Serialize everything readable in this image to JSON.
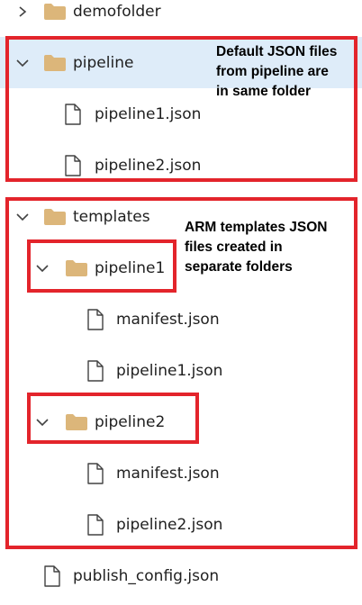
{
  "tree": {
    "rows": [
      {
        "label": "demofolder",
        "kind": "folder",
        "expanded": false,
        "selected": false
      },
      {
        "label": "pipeline",
        "kind": "folder",
        "expanded": true,
        "selected": true
      },
      {
        "label": "pipeline1.json",
        "kind": "file"
      },
      {
        "label": "pipeline2.json",
        "kind": "file"
      },
      {
        "label": "templates",
        "kind": "folder",
        "expanded": true,
        "selected": false
      },
      {
        "label": "pipeline1",
        "kind": "folder",
        "expanded": true,
        "selected": false
      },
      {
        "label": "manifest.json",
        "kind": "file"
      },
      {
        "label": "pipeline1.json",
        "kind": "file"
      },
      {
        "label": "pipeline2",
        "kind": "folder",
        "expanded": true,
        "selected": false
      },
      {
        "label": "manifest.json",
        "kind": "file"
      },
      {
        "label": "pipeline2.json",
        "kind": "file"
      },
      {
        "label": "publish_config.json",
        "kind": "file"
      }
    ]
  },
  "annotations": {
    "note1": "Default JSON files\nfrom pipeline are\nin same folder",
    "note2": "ARM templates JSON\nfiles created in\nseparate folders"
  },
  "colors": {
    "folder": "#dcb67a",
    "selection": "#deecf9",
    "highlight_border": "#e3242b",
    "icon_stroke": "#424242"
  }
}
